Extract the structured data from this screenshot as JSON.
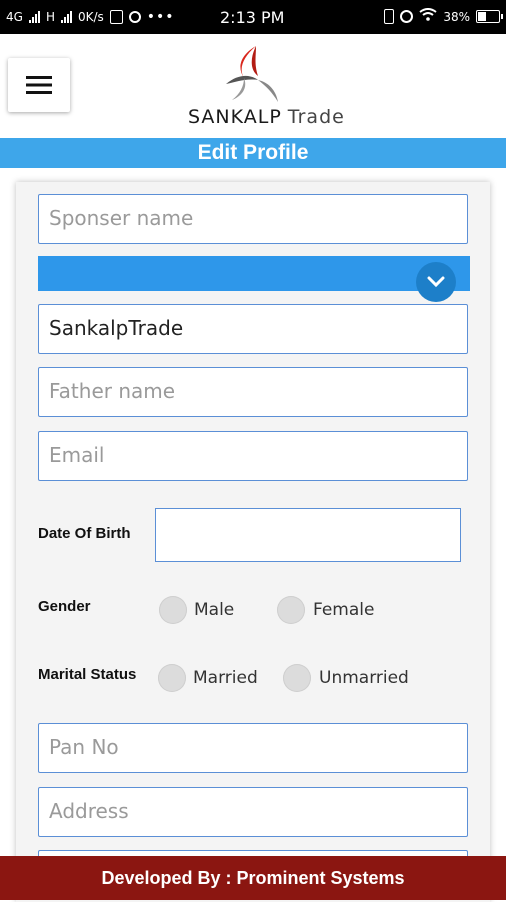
{
  "status_bar": {
    "network": "4G",
    "network2": "H",
    "speed": "0K/s",
    "time": "2:13 PM",
    "battery": "38%",
    "icons": [
      "signal-icon",
      "signal-icon",
      "sim-icon",
      "chrome-icon",
      "more-icon",
      "vibrate-icon",
      "alarm-icon",
      "wifi-icon",
      "battery-icon"
    ]
  },
  "header": {
    "logo_word1": "SANKALP",
    "logo_word2": "Trade"
  },
  "page_title": "Edit Profile",
  "form": {
    "sponser_placeholder": "Sponser name",
    "name_value": "SankalpTrade",
    "father_placeholder": "Father name",
    "email_placeholder": "Email",
    "dob_label": "Date Of Birth",
    "dob_value": "",
    "gender_label": "Gender",
    "gender_options": [
      "Male",
      "Female"
    ],
    "marital_label": "Marital Status",
    "marital_options": [
      "Married",
      "Unmarried"
    ],
    "pan_placeholder": "Pan No",
    "address_placeholder": "Address"
  },
  "footer": {
    "text": "Developed By : Prominent Systems"
  },
  "colors": {
    "title_bar": "#3ea6ea",
    "select_bar": "#2e97ea",
    "field_border": "#5b8fd6",
    "footer": "#8b1611"
  }
}
